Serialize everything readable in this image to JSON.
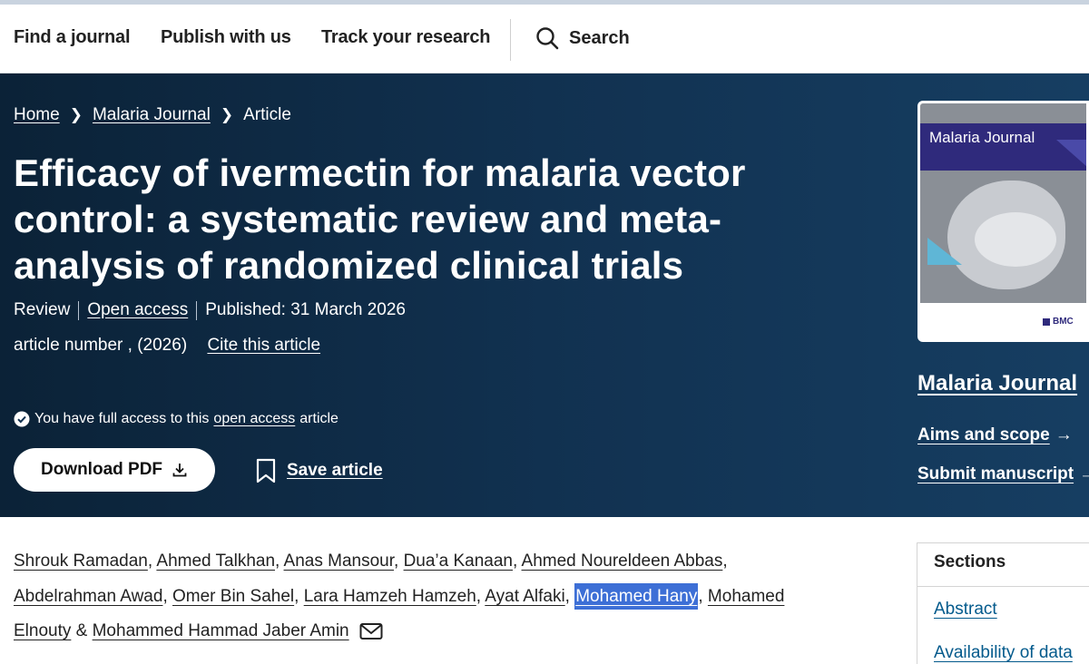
{
  "nav": {
    "items": [
      "Find a journal",
      "Publish with us",
      "Track your research"
    ],
    "search_label": "Search"
  },
  "breadcrumb": [
    "Home",
    "Malaria Journal",
    "Article"
  ],
  "article": {
    "title": "Efficacy of ivermectin for malaria vector control: a systematic review and meta-analysis of randomized clinical trials",
    "type": "Review",
    "access_label": "Open access",
    "published": "Published: 31 March 2026",
    "article_number": "article number , (2026)",
    "cite_label": "Cite this article",
    "access_notice": {
      "prefix": "You have full access to this",
      "link": "open access",
      "suffix": "article"
    },
    "download_label": "Download PDF",
    "save_label": "Save article"
  },
  "journal": {
    "cover_title": "Malaria Journal",
    "publisher_logo": "BMC",
    "name": "Malaria Journal",
    "links": [
      "Aims and scope",
      "Submit manuscript"
    ]
  },
  "authors": [
    "Shrouk Ramadan",
    "Ahmed Talkhan",
    "Anas Mansour",
    "Dua’a Kanaan",
    "Ahmed Noureldeen Abbas",
    "Abdelrahman Awad",
    "Omer Bin Sahel",
    "Lara Hamzeh Hamzeh",
    "Ayat Alfaki",
    "Mohamed Hany",
    "Mohamed Elnouty",
    "Mohammed Hammad Jaber Amin"
  ],
  "highlighted_author": "Mohamed Hany",
  "sections": {
    "heading": "Sections",
    "items": [
      "Abstract",
      "Availability of data"
    ]
  },
  "colors": {
    "hero_bg": "#113150",
    "highlight": "#3d6fd6",
    "link": "#035a8c"
  }
}
